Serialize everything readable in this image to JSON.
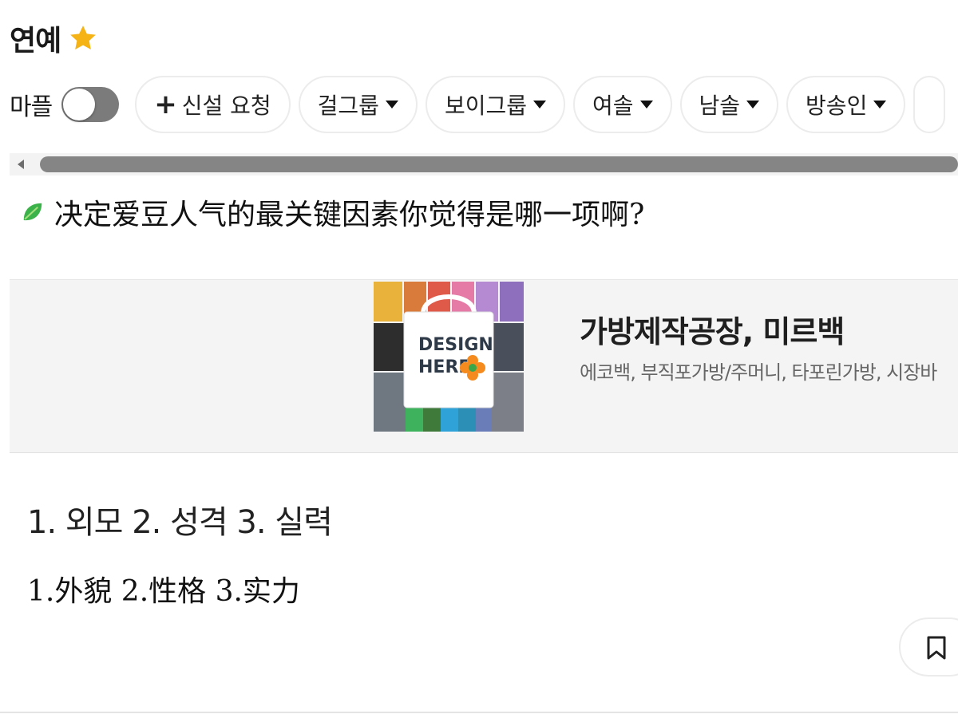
{
  "header": {
    "title": "연예",
    "icon": "star-icon",
    "icon_color": "#f5b316"
  },
  "filters": {
    "toggle_label": "마플",
    "toggle_on": false,
    "request_label": "신설 요청",
    "chips": [
      {
        "label": "걸그룹"
      },
      {
        "label": "보이그룹"
      },
      {
        "label": "여솔"
      },
      {
        "label": "남솔"
      },
      {
        "label": "방송인"
      }
    ]
  },
  "post": {
    "question": "决定爱豆人气的最关键因素你觉得是哪一项啊?",
    "question_icon": "leaf-icon",
    "korean_options": "1. 외모 2. 성격 3. 실력",
    "chinese_options": "1.外貌 2.性格 3.实力"
  },
  "ad": {
    "image_text_line1": "DESIGN",
    "image_text_line2": "HERE",
    "title": "가방제작공장, 미르백",
    "description": "에코백, 부직포가방/주머니, 타포린가방, 시장바"
  },
  "actions": {
    "bookmark_icon": "bookmark-icon"
  }
}
